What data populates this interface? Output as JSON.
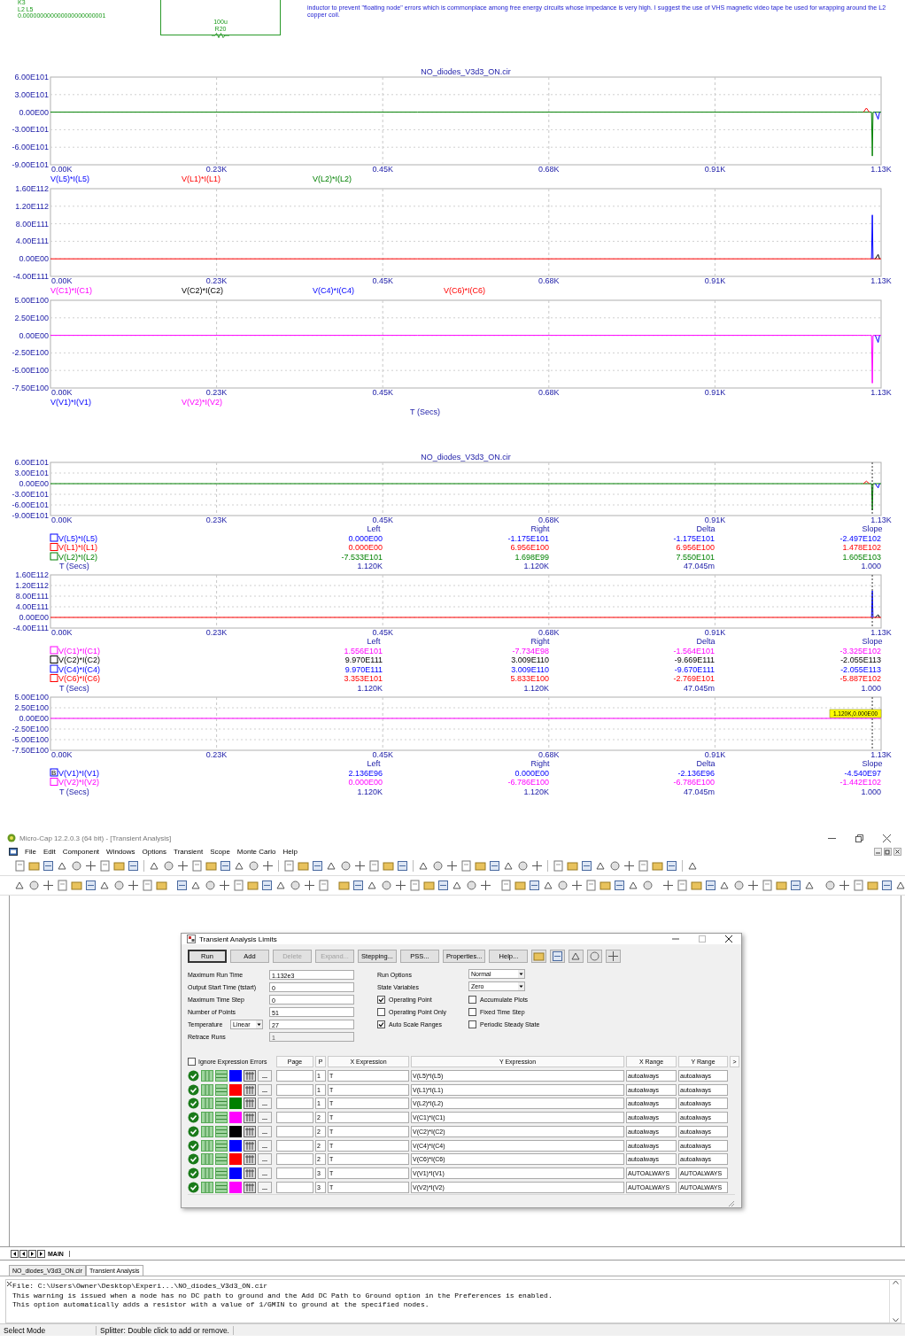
{
  "schematic": {
    "labels": [
      "K3",
      "L2 L5",
      "0.000000000000000000000001"
    ],
    "component": {
      "value": "100u",
      "name": "R20"
    },
    "note": "inductor to prevent \"floating node\" errors which is commonplace among free energy circuits whose impedance is very high. I suggest the use of VHS magnetic video tape be used for wrapping around the L2 copper coil."
  },
  "plots": [
    {
      "panels": [
        {
          "chart_data": {
            "type": "line",
            "title": "NO_diodes_V3d3_ON.cir",
            "grid": true,
            "legend": "below",
            "x": [
              0,
              0.5,
              1.1,
              1.108,
              1.112,
              1.116,
              1.119,
              1.12,
              1.121,
              1.124,
              1.128,
              1.13,
              1.132
            ],
            "xlim": [
              0,
              1.132
            ],
            "ylim": [
              -9e+101,
              6e+101
            ],
            "xticks": [
              {
                "value": 0,
                "label": "0.00K"
              },
              {
                "value": 0.2264,
                "label": "0.23K"
              },
              {
                "value": 0.4528,
                "label": "0.45K"
              },
              {
                "value": 0.6792,
                "label": "0.68K"
              },
              {
                "value": 0.9056,
                "label": "0.91K"
              },
              {
                "value": 1.132,
                "label": "1.13K"
              }
            ],
            "yticks": [
              {
                "value": 6e+101,
                "label": "6.00E101"
              },
              {
                "value": 3e+101,
                "label": "3.00E101"
              },
              {
                "value": 0,
                "label": "0.00E00"
              },
              {
                "value": -3e+101,
                "label": "-3.00E101"
              },
              {
                "value": -6e+101,
                "label": "-6.00E101"
              },
              {
                "value": -9e+101,
                "label": "-9.00E101"
              }
            ],
            "series": [
              {
                "name": "V(L5)*I(L5)",
                "color": "#0000ff",
                "values": [
                  null,
                  null,
                  null,
                  null,
                  null,
                  null,
                  null,
                  null,
                  null,
                  0,
                  -1.2e+101,
                  0,
                  null
                ]
              },
              {
                "name": "V(L1)*I(L1)",
                "color": "#ff0000",
                "values": [
                  null,
                  null,
                  null,
                  0,
                  7e+100,
                  0,
                  null,
                  null,
                  null,
                  null,
                  null,
                  null,
                  null
                ]
              },
              {
                "name": "V(L2)*I(L2)",
                "color": "#008000",
                "values": [
                  0,
                  0,
                  0,
                  null,
                  null,
                  null,
                  0,
                  -7.5e+101,
                  0,
                  null,
                  null,
                  null,
                  0
                ]
              }
            ]
          }
        },
        {
          "chart_data": {
            "type": "line",
            "grid": true,
            "legend": "below",
            "x": [
              0,
              0.5,
              1.1,
              1.108,
              1.112,
              1.116,
              1.119,
              1.12,
              1.121,
              1.124,
              1.128,
              1.13,
              1.132
            ],
            "xlim": [
              0,
              1.132
            ],
            "ylim": [
              -4e+111,
              1.6e+112
            ],
            "xticks": [
              {
                "value": 0,
                "label": "0.00K"
              },
              {
                "value": 0.2264,
                "label": "0.23K"
              },
              {
                "value": 0.4528,
                "label": "0.45K"
              },
              {
                "value": 0.6792,
                "label": "0.68K"
              },
              {
                "value": 0.9056,
                "label": "0.91K"
              },
              {
                "value": 1.132,
                "label": "1.13K"
              }
            ],
            "yticks": [
              {
                "value": 1.6e+112,
                "label": "1.60E112"
              },
              {
                "value": 1.2e+112,
                "label": "1.20E112"
              },
              {
                "value": 8e+111,
                "label": "8.00E111"
              },
              {
                "value": 4e+111,
                "label": "4.00E111"
              },
              {
                "value": 0,
                "label": "0.00E00"
              },
              {
                "value": -4e+111,
                "label": "-4.00E111"
              }
            ],
            "series": [
              {
                "name": "V(C1)*I(C1)",
                "color": "#ff00ff",
                "values": [
                  null,
                  null,
                  null,
                  null,
                  null,
                  null,
                  null,
                  null,
                  null,
                  null,
                  null,
                  null,
                  null
                ]
              },
              {
                "name": "V(C2)*I(C2)",
                "color": "#000000",
                "values": [
                  null,
                  null,
                  null,
                  null,
                  null,
                  null,
                  null,
                  null,
                  null,
                  0,
                  1e+111,
                  0,
                  null
                ]
              },
              {
                "name": "V(C4)*I(C4)",
                "color": "#0000ff",
                "values": [
                  null,
                  null,
                  null,
                  null,
                  null,
                  null,
                  0,
                  1e+112,
                  0,
                  null,
                  null,
                  null,
                  null
                ]
              },
              {
                "name": "V(C6)*I(C6)",
                "color": "#ff0000",
                "values": [
                  0,
                  0,
                  0,
                  0,
                  0,
                  0,
                  null,
                  null,
                  null,
                  null,
                  null,
                  null,
                  0
                ]
              }
            ]
          }
        },
        {
          "chart_data": {
            "type": "line",
            "xlabel": "T (Secs)",
            "grid": true,
            "legend": "below",
            "x": [
              0,
              0.5,
              1.1,
              1.108,
              1.112,
              1.116,
              1.119,
              1.12,
              1.121,
              1.124,
              1.128,
              1.13,
              1.132
            ],
            "xlim": [
              0,
              1.132
            ],
            "ylim": [
              -7.5e+100,
              5e+100
            ],
            "xticks": [
              {
                "value": 0,
                "label": "0.00K"
              },
              {
                "value": 0.2264,
                "label": "0.23K"
              },
              {
                "value": 0.4528,
                "label": "0.45K"
              },
              {
                "value": 0.6792,
                "label": "0.68K"
              },
              {
                "value": 0.9056,
                "label": "0.91K"
              },
              {
                "value": 1.132,
                "label": "1.13K"
              }
            ],
            "yticks": [
              {
                "value": 5e+100,
                "label": "5.00E100"
              },
              {
                "value": 2.5e+100,
                "label": "2.50E100"
              },
              {
                "value": 0,
                "label": "0.00E00"
              },
              {
                "value": -2.5e+100,
                "label": "-2.50E100"
              },
              {
                "value": -5e+100,
                "label": "-5.00E100"
              },
              {
                "value": -7.5e+100,
                "label": "-7.50E100"
              }
            ],
            "series": [
              {
                "name": "V(V1)*I(V1)",
                "color": "#0000ff",
                "values": [
                  null,
                  null,
                  null,
                  null,
                  null,
                  null,
                  null,
                  null,
                  null,
                  0,
                  -1e+100,
                  0,
                  null
                ]
              },
              {
                "name": "V(V2)*I(V2)",
                "color": "#ff00ff",
                "values": [
                  0,
                  0,
                  0,
                  0,
                  0,
                  0,
                  0,
                  -6.8e+100,
                  0,
                  null,
                  null,
                  null,
                  0
                ]
              }
            ]
          }
        }
      ]
    },
    {
      "panels": [
        {
          "chart_data": {
            "type": "line",
            "title": "NO_diodes_V3d3_ON.cir",
            "grid": true,
            "legend": "below",
            "x": [
              0,
              0.5,
              1.1,
              1.108,
              1.112,
              1.116,
              1.119,
              1.12,
              1.121,
              1.124,
              1.128,
              1.13,
              1.132
            ],
            "xlim": [
              0,
              1.132
            ],
            "ylim": [
              -9e+101,
              6e+101
            ],
            "xticks": [
              {
                "value": 0,
                "label": "0.00K"
              },
              {
                "value": 0.2264,
                "label": "0.23K"
              },
              {
                "value": 0.4528,
                "label": "0.45K"
              },
              {
                "value": 0.6792,
                "label": "0.68K"
              },
              {
                "value": 0.9056,
                "label": "0.91K"
              },
              {
                "value": 1.132,
                "label": "1.13K"
              }
            ],
            "yticks": [
              {
                "value": 6e+101,
                "label": "6.00E101"
              },
              {
                "value": 3e+101,
                "label": "3.00E101"
              },
              {
                "value": 0,
                "label": "0.00E00"
              },
              {
                "value": -3e+101,
                "label": "-3.00E101"
              },
              {
                "value": -6e+101,
                "label": "-6.00E101"
              },
              {
                "value": -9e+101,
                "label": "-9.00E101"
              }
            ],
            "ref_lines": [
              {
                "axis": "x",
                "value": 1.12
              }
            ],
            "series": [
              {
                "name": "V(L5)*I(L5)",
                "color": "#0000ff",
                "values": [
                  null,
                  null,
                  null,
                  null,
                  null,
                  null,
                  null,
                  null,
                  null,
                  0,
                  -1.2e+101,
                  0,
                  null
                ]
              },
              {
                "name": "V(L1)*I(L1)",
                "color": "#ff0000",
                "values": [
                  null,
                  null,
                  null,
                  0,
                  7e+100,
                  0,
                  null,
                  null,
                  null,
                  null,
                  null,
                  null,
                  null
                ]
              },
              {
                "name": "V(L2)*I(L2)",
                "color": "#008000",
                "values": [
                  0,
                  0,
                  0,
                  null,
                  null,
                  null,
                  0,
                  -7.5e+101,
                  0,
                  null,
                  null,
                  null,
                  0
                ]
              }
            ]
          },
          "cursor": {
            "columns": [
              "Left",
              "Right",
              "Delta",
              "Slope"
            ],
            "rows": [
              {
                "values": [
                  "0.000E00",
                  "-1.175E101",
                  "-1.175E101",
                  "-2.497E102"
                ]
              },
              {
                "values": [
                  "0.000E00",
                  "6.956E100",
                  "6.956E100",
                  "1.478E102"
                ]
              },
              {
                "values": [
                  "-7.533E101",
                  "1.698E99",
                  "7.550E101",
                  "1.605E103"
                ]
              }
            ],
            "time_row": {
              "label": "T (Secs)",
              "values": [
                "1.120K",
                "1.120K",
                "47.045m",
                "1.000"
              ]
            }
          }
        },
        {
          "chart_data": {
            "type": "line",
            "grid": true,
            "legend": "below",
            "x": [
              0,
              0.5,
              1.1,
              1.108,
              1.112,
              1.116,
              1.119,
              1.12,
              1.121,
              1.124,
              1.128,
              1.13,
              1.132
            ],
            "xlim": [
              0,
              1.132
            ],
            "ylim": [
              -4e+111,
              1.6e+112
            ],
            "xticks": [
              {
                "value": 0,
                "label": "0.00K"
              },
              {
                "value": 0.2264,
                "label": "0.23K"
              },
              {
                "value": 0.4528,
                "label": "0.45K"
              },
              {
                "value": 0.6792,
                "label": "0.68K"
              },
              {
                "value": 0.9056,
                "label": "0.91K"
              },
              {
                "value": 1.132,
                "label": "1.13K"
              }
            ],
            "yticks": [
              {
                "value": 1.6e+112,
                "label": "1.60E112"
              },
              {
                "value": 1.2e+112,
                "label": "1.20E112"
              },
              {
                "value": 8e+111,
                "label": "8.00E111"
              },
              {
                "value": 4e+111,
                "label": "4.00E111"
              },
              {
                "value": 0,
                "label": "0.00E00"
              },
              {
                "value": -4e+111,
                "label": "-4.00E111"
              }
            ],
            "ref_lines": [
              {
                "axis": "x",
                "value": 1.12
              }
            ],
            "series": [
              {
                "name": "V(C1)*I(C1)",
                "color": "#ff00ff",
                "values": [
                  null,
                  null,
                  null,
                  null,
                  null,
                  null,
                  null,
                  null,
                  null,
                  null,
                  null,
                  null,
                  null
                ]
              },
              {
                "name": "V(C2)*I(C2)",
                "color": "#000000",
                "values": [
                  null,
                  null,
                  null,
                  null,
                  null,
                  null,
                  null,
                  null,
                  null,
                  0,
                  1e+111,
                  0,
                  null
                ]
              },
              {
                "name": "V(C4)*I(C4)",
                "color": "#0000ff",
                "values": [
                  null,
                  null,
                  null,
                  null,
                  null,
                  null,
                  0,
                  1e+112,
                  0,
                  null,
                  null,
                  null,
                  null
                ]
              },
              {
                "name": "V(C6)*I(C6)",
                "color": "#ff0000",
                "values": [
                  0,
                  0,
                  0,
                  0,
                  0,
                  0,
                  null,
                  null,
                  null,
                  null,
                  null,
                  null,
                  0
                ]
              }
            ]
          },
          "cursor": {
            "columns": [
              "Left",
              "Right",
              "Delta",
              "Slope"
            ],
            "rows": [
              {
                "values": [
                  "1.556E101",
                  "-7.734E98",
                  "-1.564E101",
                  "-3.325E102"
                ]
              },
              {
                "values": [
                  "9.970E111",
                  "3.009E110",
                  "-9.669E111",
                  "-2.055E113"
                ]
              },
              {
                "values": [
                  "9.970E111",
                  "3.009E110",
                  "-9.670E111",
                  "-2.055E113"
                ]
              },
              {
                "values": [
                  "3.353E101",
                  "5.833E100",
                  "-2.769E101",
                  "-5.887E102"
                ]
              }
            ],
            "time_row": {
              "label": "T (Secs)",
              "values": [
                "1.120K",
                "1.120K",
                "47.045m",
                "1.000"
              ]
            }
          }
        },
        {
          "chart_data": {
            "type": "line",
            "grid": true,
            "legend": "below",
            "x": [
              0,
              0.5,
              1.1,
              1.108,
              1.112,
              1.116,
              1.119,
              1.12,
              1.121,
              1.124,
              1.128,
              1.13,
              1.132
            ],
            "xlim": [
              0,
              1.132
            ],
            "ylim": [
              -7.5e+100,
              5e+100
            ],
            "xticks": [
              {
                "value": 0,
                "label": "0.00K"
              },
              {
                "value": 0.2264,
                "label": "0.23K"
              },
              {
                "value": 0.4528,
                "label": "0.45K"
              },
              {
                "value": 0.6792,
                "label": "0.68K"
              },
              {
                "value": 0.9056,
                "label": "0.91K"
              },
              {
                "value": 1.132,
                "label": "1.13K"
              }
            ],
            "yticks": [
              {
                "value": 5e+100,
                "label": "5.00E100"
              },
              {
                "value": 2.5e+100,
                "label": "2.50E100"
              },
              {
                "value": 0,
                "label": "0.00E00"
              },
              {
                "value": -2.5e+100,
                "label": "-2.50E100"
              },
              {
                "value": -5e+100,
                "label": "-5.00E100"
              },
              {
                "value": -7.5e+100,
                "label": "-7.50E100"
              }
            ],
            "ref_lines": [
              {
                "axis": "x",
                "value": 1.12
              }
            ],
            "annotations": [
              {
                "x": 1.132,
                "y": 0,
                "text": "1.120K,0.000E00"
              }
            ],
            "series": [
              {
                "name": "V(V1)*I(V1)",
                "color": "#0000ff",
                "values": [
                  null,
                  null,
                  null,
                  null,
                  null,
                  null,
                  null,
                  null,
                  null,
                  null,
                  null,
                  null,
                  null
                ]
              },
              {
                "name": "V(V2)*I(V2)",
                "color": "#ff00ff",
                "values": [
                  0,
                  0,
                  0,
                  0,
                  0,
                  0,
                  0,
                  0,
                  0,
                  0,
                  0,
                  0,
                  0
                ]
              }
            ]
          },
          "cursor": {
            "columns": [
              "Left",
              "Right",
              "Delta",
              "Slope"
            ],
            "rows": [
              {
                "box_text": "B",
                "values": [
                  "2.136E96",
                  "0.000E00",
                  "-2.136E96",
                  "-4.540E97"
                ]
              },
              {
                "values": [
                  "0.000E00",
                  "-6.786E100",
                  "-6.786E100",
                  "-1.442E102"
                ]
              }
            ],
            "time_row": {
              "label": "T (Secs)",
              "values": [
                "1.120K",
                "1.120K",
                "47.045m",
                "1.000"
              ]
            }
          }
        }
      ]
    }
  ],
  "app": {
    "title": "Micro-Cap 12.2.0.3 (64 bit) - [Transient Analysis]",
    "menu": [
      "File",
      "Edit",
      "Component",
      "Windows",
      "Options",
      "Transient",
      "Scope",
      "Monte Carlo",
      "Help"
    ],
    "dialog": {
      "title": "Transient Analysis Limits",
      "buttons": [
        {
          "label": "Run",
          "default": true,
          "disabled": false
        },
        {
          "label": "Add",
          "default": false,
          "disabled": false
        },
        {
          "label": "Delete",
          "default": false,
          "disabled": true
        },
        {
          "label": "Expand...",
          "default": false,
          "disabled": true
        },
        {
          "label": "Stepping...",
          "default": false,
          "disabled": false
        },
        {
          "label": "PSS...",
          "default": false,
          "disabled": false
        },
        {
          "label": "Properties...",
          "default": false,
          "disabled": false
        },
        {
          "label": "Help...",
          "default": false,
          "disabled": false
        }
      ],
      "fields": [
        {
          "label": "Maximum Run Time",
          "value": "1.132e3",
          "disabled": false
        },
        {
          "label": "Output Start Time (tstart)",
          "value": "0",
          "disabled": false
        },
        {
          "label": "Maximum Time Step",
          "value": "0",
          "disabled": false
        },
        {
          "label": "Number of Points",
          "value": "51",
          "disabled": false
        },
        {
          "label": "Temperature",
          "select": "Linear",
          "value": "27",
          "disabled": false
        },
        {
          "label": "Retrace Runs",
          "value": "1",
          "disabled": true
        }
      ],
      "selects": [
        {
          "label": "Run Options",
          "value": "Normal"
        },
        {
          "label": "State Variables",
          "value": "Zero"
        }
      ],
      "options": [
        {
          "label": "Operating Point",
          "checked": true
        },
        {
          "label": "Accumulate Plots",
          "checked": false
        },
        {
          "label": "Operating Point Only",
          "checked": false
        },
        {
          "label": "Fixed Time Step",
          "checked": false
        },
        {
          "label": "Auto Scale Ranges",
          "checked": true
        },
        {
          "label": "Periodic Steady State",
          "checked": false
        }
      ],
      "ignore_errors": {
        "label": "Ignore Expression Errors",
        "checked": false
      },
      "table": {
        "columns": [
          "Page",
          "P",
          "X Expression",
          "Y Expression",
          "X Range",
          "Y Range",
          ">"
        ],
        "rows": [
          {
            "color": "#0000ff",
            "button": "...",
            "p": "1",
            "x": "T",
            "y": "V(L5)*I(L5)",
            "x_range": "autoalways",
            "y_range": "autoalways"
          },
          {
            "color": "#ff0000",
            "button": "...",
            "p": "1",
            "x": "T",
            "y": "V(L1)*I(L1)",
            "x_range": "autoalways",
            "y_range": "autoalways"
          },
          {
            "color": "#008000",
            "button": "...",
            "p": "1",
            "x": "T",
            "y": "V(L2)*I(L2)",
            "x_range": "autoalways",
            "y_range": "autoalways"
          },
          {
            "color": "#ff00ff",
            "button": "...",
            "p": "2",
            "x": "T",
            "y": "V(C1)*I(C1)",
            "x_range": "autoalways",
            "y_range": "autoalways"
          },
          {
            "color": "#000000",
            "button": "...",
            "p": "2",
            "x": "T",
            "y": "V(C2)*I(C2)",
            "x_range": "autoalways",
            "y_range": "autoalways"
          },
          {
            "color": "#0000ff",
            "button": "...",
            "p": "2",
            "x": "T",
            "y": "V(C4)*I(C4)",
            "x_range": "autoalways",
            "y_range": "autoalways"
          },
          {
            "color": "#ff0000",
            "button": "...",
            "p": "2",
            "x": "T",
            "y": "V(C6)*I(C6)",
            "x_range": "autoalways",
            "y_range": "autoalways"
          },
          {
            "color": "#0000ff",
            "button": "...",
            "p": "3",
            "x": "T",
            "y": "V(V1)*I(V1)",
            "x_range": "AUTOALWAYS",
            "y_range": "AUTOALWAYS"
          },
          {
            "color": "#ff00ff",
            "button": "...",
            "p": "3",
            "x": "T",
            "y": "V(V2)*I(V2)",
            "x_range": "AUTOALWAYS",
            "y_range": "AUTOALWAYS"
          }
        ]
      }
    },
    "page_tabs": [
      {
        "label": "MAIN",
        "selected": true
      }
    ],
    "file_tabs": [
      {
        "label": "NO_diodes_V3d3_ON.cir",
        "selected": false
      },
      {
        "label": "Transient Analysis",
        "selected": true
      }
    ],
    "output": [
      "File: C:\\Users\\Owner\\Desktop\\Experi...\\NO_diodes_V3d3_ON.cir",
      "This warning is issued when a node has no DC path to ground and the Add DC Path to Ground option in the Preferences is enabled.",
      "This option automatically adds a resistor with a value of 1/GMIN to ground at the specified nodes."
    ],
    "status_bar": [
      "Select Mode",
      "Splitter: Double click to add or remove."
    ]
  }
}
